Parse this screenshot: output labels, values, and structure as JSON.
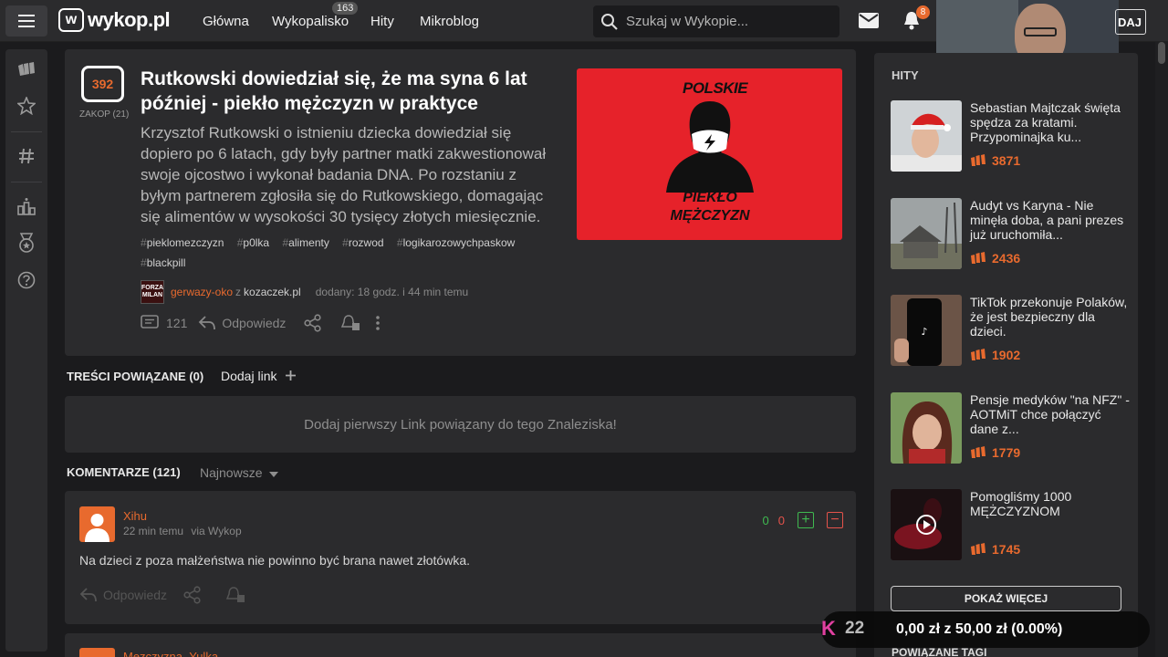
{
  "header": {
    "logo_text": "wykop.pl",
    "logo_mark": "w",
    "nav": [
      {
        "label": "Główna"
      },
      {
        "label": "Wykopalisko",
        "badge": "163"
      },
      {
        "label": "Hity"
      },
      {
        "label": "Mikroblog"
      }
    ],
    "search_placeholder": "Szukaj w Wykopie...",
    "notification_count": "8",
    "login_label": "DAJ"
  },
  "article": {
    "votes": "392",
    "bury_label": "ZAKOP (21)",
    "title": "Rutkowski dowiedział się, że ma syna 6 lat później - piekło mężczyzn w praktyce",
    "description": "Krzysztof Rutkowski o istnieniu dziecka dowiedział się dopiero po 6 latach, gdy były partner matki zakwestionował swoje ojcostwo i wykonał badania DNA. Po rozstaniu z byłym partnerem zgłosiła się do Rutkowskiego, domagając się alimentów w wysokości 30 tysięcy złotych miesięcznie.",
    "tags": [
      "pieklomezczyzn",
      "p0lka",
      "alimenty",
      "rozwod",
      "logikarozowychpaskow",
      "blackpill"
    ],
    "tag_prefix": "#",
    "author_avatar_text": "FORZA MILAN",
    "author": "gerwazy-oko",
    "source_sep": "z",
    "source": "kozaczek.pl",
    "added": "dodany: 18 godz. i 44 min temu",
    "comment_count": "121",
    "reply_label": "Odpowiedz",
    "image_text_top": "POLSKIE",
    "image_text_bottom": "PIEKŁO MĘŻCZYZN"
  },
  "related": {
    "heading": "TREŚCI POWIĄZANE (0)",
    "add_label": "Dodaj link",
    "empty_text": "Dodaj pierwszy Link powiązany do tego Znaleziska!"
  },
  "comments": {
    "heading": "KOMENTARZE (121)",
    "sort_label": "Najnowsze",
    "items": [
      {
        "author": "Xihu",
        "time": "22 min temu",
        "via": "via Wykop",
        "plus": "0",
        "minus": "0",
        "text": "Na dzieci z poza małżeństwa nie powinno być brana nawet złotówka.",
        "reply_label": "Odpowiedz"
      }
    ],
    "next_author": "Mezczyzna_Yulka"
  },
  "sidebar": {
    "heading": "HITY",
    "items": [
      {
        "title": "Sebastian Majtczak święta spędza za kratami. Przypominajka ku...",
        "score": "3871"
      },
      {
        "title": "Audyt vs Karyna - Nie minęła doba, a pani prezes już uruchomiła...",
        "score": "2436"
      },
      {
        "title": "TikTok przekonuje Polaków, że jest bezpieczny dla dzieci.",
        "score": "1902"
      },
      {
        "title": "Pensje medyków \"na NFZ\" - AOTMiT chce połączyć dane z...",
        "score": "1779"
      },
      {
        "title": "Pomogliśmy 1000 MĘŻCZYZNOM",
        "score": "1745"
      }
    ],
    "more_label": "POKAŻ WIĘCEJ",
    "related_tags": "POWIĄZANE TAGI"
  },
  "donation": {
    "k_label": "K",
    "k_count": "22",
    "amount": "0,00 zł z 50,00 zł (0.00%)"
  },
  "colors": {
    "accent": "#e86a2e",
    "background": "#1b1b1d",
    "panel": "#2b2b2d",
    "plus": "#3fb950",
    "minus": "#e5534b"
  }
}
